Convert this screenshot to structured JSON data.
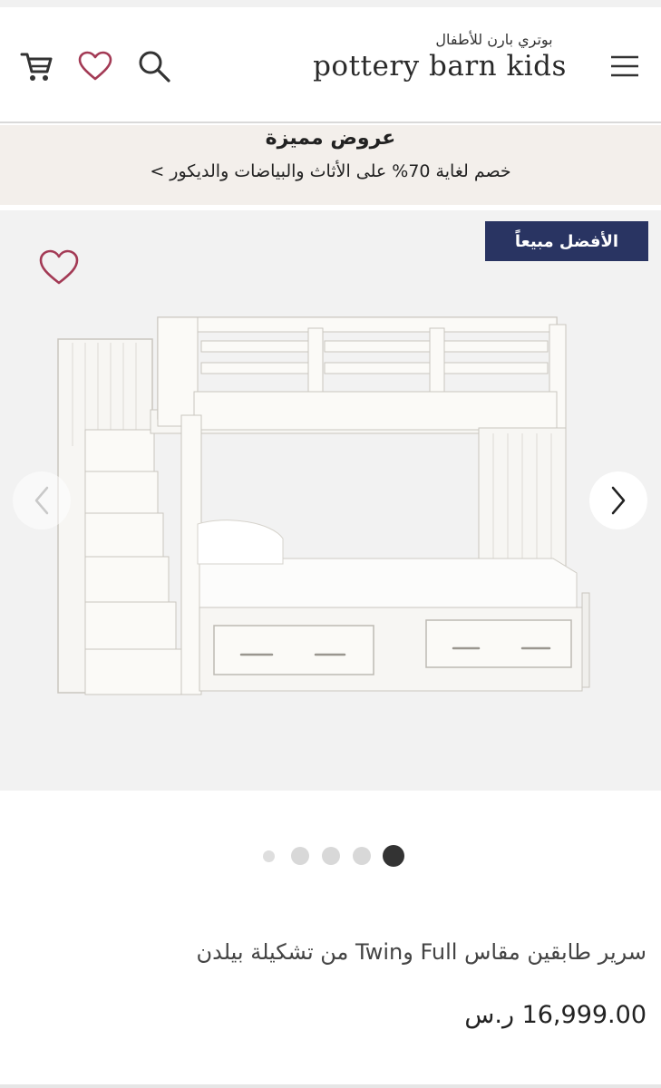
{
  "header": {
    "logo_arabic": "بوتري بارن للأطفال",
    "logo_english": "pottery barn kids",
    "icons": [
      "cart-icon",
      "heart-icon",
      "search-icon",
      "menu-icon"
    ]
  },
  "promo": {
    "title": "عروض مميزة",
    "subtitle": "خصم لغاية 70% على الأثاث والبياضات والديكور >"
  },
  "product": {
    "badge": "الأفضل مبيعاً",
    "title": "سرير طابقين مقاس Full وTwin من تشكيلة بيلدن",
    "price": "16,999.00 ر.س",
    "image_count": 5,
    "active_image_index": 4
  },
  "colors": {
    "badge_bg": "#293462",
    "heart": "#a33a55",
    "promo_bg": "#f3efeb",
    "gallery_bg": "#f2f2f2"
  }
}
